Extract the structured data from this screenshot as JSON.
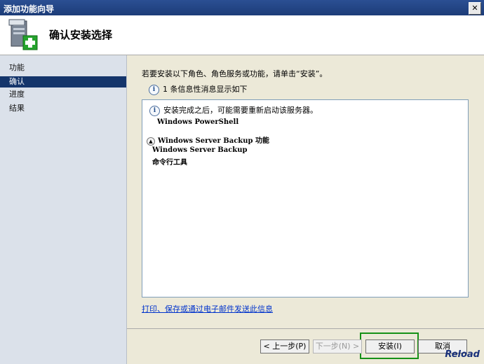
{
  "window": {
    "title": "添加功能向导",
    "close_glyph": "✕"
  },
  "header": {
    "title": "确认安装选择",
    "icon": "server-add-icon"
  },
  "sidebar": {
    "items": [
      {
        "label": "功能",
        "active": false
      },
      {
        "label": "确认",
        "active": true
      },
      {
        "label": "进度",
        "active": false
      },
      {
        "label": "结果",
        "active": false
      }
    ]
  },
  "content": {
    "instruction": "若要安装以下角色、角色服务或功能，请单击“安装”。",
    "info_line": "1 条信息性消息显示如下",
    "results": {
      "restart_notice": "安装完成之后，可能需要重新启动该服务器。",
      "powershell": "Windows PowerShell",
      "feature_heading": "Windows Server Backup 功能",
      "sub_items": [
        "Windows Server Backup",
        "命令行工具"
      ]
    },
    "link": "打印、保存或通过电子邮件发送此信息"
  },
  "buttons": {
    "prev": "< 上一步(P)",
    "next": "下一步(N) >",
    "install": "安装(I)",
    "cancel": "取消"
  },
  "overlay": {
    "reload": "Reload"
  },
  "colors": {
    "active": "#14356b",
    "focus": "#169116",
    "link": "#0033cc"
  }
}
